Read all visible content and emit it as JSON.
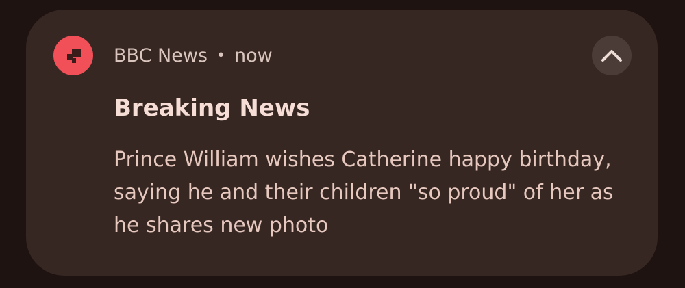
{
  "notification": {
    "app_name": "BBC News",
    "separator": "•",
    "time": "now",
    "title": "Breaking News",
    "body": "Prince William wishes Catherine happy birthday, saying he and their children \"so proud\" of her as he shares new photo",
    "app_icon": "bbc-news-logo-icon",
    "expand_icon": "chevron-up-icon"
  },
  "colors": {
    "background": "#1e1310",
    "card": "#362722",
    "app_icon_bg": "#f25058",
    "title_text": "#f6ddd5",
    "body_text": "#e6c8bf",
    "header_text": "#d9c5be",
    "button_bg": "#4c3c37"
  }
}
